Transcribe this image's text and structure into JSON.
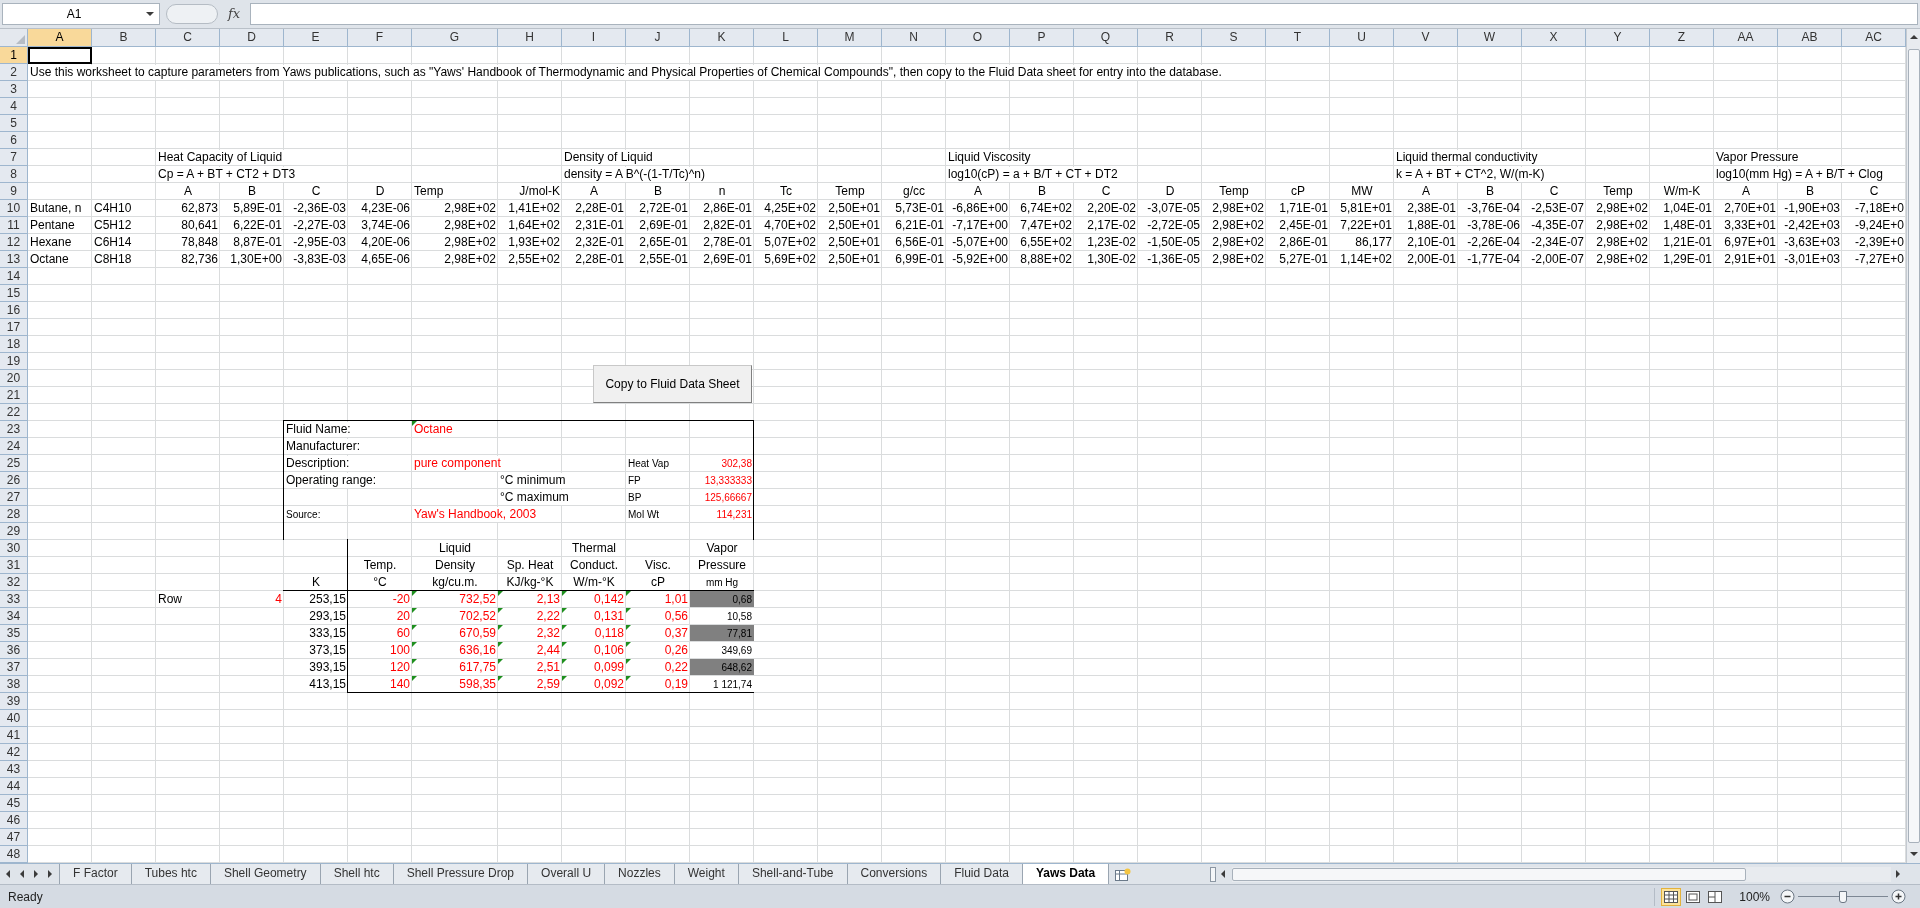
{
  "name_box": {
    "value": "A1"
  },
  "formula_bar": {
    "function_label": "fx"
  },
  "column_headers": [
    {
      "label": "A",
      "selected": true
    },
    {
      "label": "B",
      "selected": false
    },
    {
      "label": "C",
      "selected": false
    },
    {
      "label": "D",
      "selected": false
    },
    {
      "label": "E",
      "selected": false
    },
    {
      "label": "F",
      "selected": false
    },
    {
      "label": "G",
      "selected": false
    },
    {
      "label": "H",
      "selected": false
    },
    {
      "label": "I",
      "selected": false
    },
    {
      "label": "J",
      "selected": false
    },
    {
      "label": "K",
      "selected": false
    },
    {
      "label": "L",
      "selected": false
    },
    {
      "label": "M",
      "selected": false
    },
    {
      "label": "N",
      "selected": false
    },
    {
      "label": "O",
      "selected": false
    },
    {
      "label": "P",
      "selected": false
    },
    {
      "label": "Q",
      "selected": false
    },
    {
      "label": "R",
      "selected": false
    },
    {
      "label": "S",
      "selected": false
    },
    {
      "label": "T",
      "selected": false
    },
    {
      "label": "U",
      "selected": false
    },
    {
      "label": "V",
      "selected": false
    },
    {
      "label": "W",
      "selected": false
    },
    {
      "label": "X",
      "selected": false
    },
    {
      "label": "Y",
      "selected": false
    },
    {
      "label": "Z",
      "selected": false
    },
    {
      "label": "AA",
      "selected": false
    },
    {
      "label": "AB",
      "selected": false
    },
    {
      "label": "AC",
      "selected": false
    }
  ],
  "rows": [
    {
      "number": "1",
      "selected": true,
      "cells": [
        {
          "kind": "label",
          "selected": true
        }
      ]
    },
    {
      "number": "2",
      "selected": false,
      "cells": [
        {
          "text": "Use this worksheet to capture parameters from Yaws publications, such as \"Yaws' Handbook of Thermodynamic and Physical Properties of Chemical Compounds\", then copy to the Fluid Data sheet for entry into the database.",
          "kind": "label",
          "selected": false
        }
      ]
    },
    {
      "number": "3",
      "selected": false
    },
    {
      "number": "4",
      "selected": false
    },
    {
      "number": "5",
      "selected": false
    },
    {
      "number": "6",
      "selected": false
    },
    {
      "number": "7",
      "selected": false,
      "cells": [
        null,
        null,
        {
          "text": "Heat Capacity of Liquid",
          "kind": "label",
          "selected": false
        },
        null,
        null,
        null,
        null,
        null,
        {
          "text": "Density of Liquid",
          "kind": "label",
          "selected": false
        },
        null,
        null,
        null,
        null,
        null,
        {
          "text": "Liquid Viscosity",
          "kind": "label",
          "selected": false
        },
        null,
        null,
        null,
        null,
        null,
        null,
        {
          "text": "Liquid thermal conductivity",
          "kind": "label",
          "selected": false
        },
        null,
        null,
        null,
        null,
        {
          "text": "Vapor Pressure",
          "kind": "label",
          "selected": false
        }
      ]
    },
    {
      "number": "8",
      "selected": false,
      "cells": [
        null,
        null,
        {
          "text": "Cp = A + BT + CT2 + DT3",
          "kind": "label",
          "selected": false
        },
        null,
        null,
        null,
        null,
        null,
        {
          "text": "density = A B^(-(1-T/Tc)^n)",
          "kind": "label",
          "selected": false
        },
        null,
        null,
        null,
        null,
        null,
        {
          "text": "log10(cP) = a + B/T + CT + DT2",
          "kind": "label",
          "selected": false
        },
        null,
        null,
        null,
        null,
        null,
        null,
        {
          "text": "k = A + BT + CT^2, W/(m-K)",
          "kind": "label",
          "selected": false
        },
        null,
        null,
        null,
        null,
        {
          "text": "log10(mm Hg) = A + B/T + Clog",
          "kind": "label",
          "selected": false
        }
      ]
    },
    {
      "number": "9",
      "selected": false,
      "cells": [
        null,
        null,
        {
          "text": "A",
          "kind": "heading",
          "selected": false
        },
        {
          "text": "B",
          "kind": "heading",
          "selected": false
        },
        {
          "text": "C",
          "kind": "heading",
          "selected": false
        },
        {
          "text": "D",
          "kind": "heading",
          "selected": false
        },
        {
          "text": "Temp",
          "kind": "label",
          "selected": false
        },
        {
          "text": "J/mol-K",
          "kind": "number",
          "selected": false
        },
        {
          "text": "A",
          "kind": "heading",
          "selected": false
        },
        {
          "text": "B",
          "kind": "heading",
          "selected": false
        },
        {
          "text": "n",
          "kind": "heading",
          "selected": false
        },
        {
          "text": "Tc",
          "kind": "heading",
          "selected": false
        },
        {
          "text": "Temp",
          "kind": "heading",
          "selected": false
        },
        {
          "text": "g/cc",
          "kind": "heading",
          "selected": false
        },
        {
          "text": "A",
          "kind": "heading",
          "selected": false
        },
        {
          "text": "B",
          "kind": "heading",
          "selected": false
        },
        {
          "text": "C",
          "kind": "heading",
          "selected": false
        },
        {
          "text": "D",
          "kind": "heading",
          "selected": false
        },
        {
          "text": "Temp",
          "kind": "heading",
          "selected": false
        },
        {
          "text": "cP",
          "kind": "heading",
          "selected": false
        },
        {
          "text": "MW",
          "kind": "heading",
          "selected": false
        },
        {
          "text": "A",
          "kind": "heading",
          "selected": false
        },
        {
          "text": "B",
          "kind": "heading",
          "selected": false
        },
        {
          "text": "C",
          "kind": "heading",
          "selected": false
        },
        {
          "text": "Temp",
          "kind": "heading",
          "selected": false
        },
        {
          "text": "W/m-K",
          "kind": "heading",
          "selected": false
        },
        {
          "text": "A",
          "kind": "heading",
          "selected": false
        },
        {
          "text": "B",
          "kind": "heading",
          "selected": false
        },
        {
          "text": "C",
          "kind": "heading",
          "selected": false
        }
      ]
    },
    {
      "number": "10",
      "selected": false,
      "cells": [
        {
          "text": "Butane, n",
          "kind": "label",
          "selected": false
        },
        {
          "text": "C4H10",
          "kind": "label",
          "selected": false
        },
        {
          "text": "62,873",
          "kind": "number",
          "selected": false
        },
        {
          "text": "5,89E-01",
          "kind": "number",
          "selected": false
        },
        {
          "text": "-2,36E-03",
          "kind": "number",
          "selected": false
        },
        {
          "text": "4,23E-06",
          "kind": "number",
          "selected": false
        },
        {
          "text": "2,98E+02",
          "kind": "number",
          "selected": false
        },
        {
          "text": "1,41E+02",
          "kind": "number",
          "selected": false
        },
        {
          "text": "2,28E-01",
          "kind": "number",
          "selected": false
        },
        {
          "text": "2,72E-01",
          "kind": "number",
          "selected": false
        },
        {
          "text": "2,86E-01",
          "kind": "number",
          "selected": false
        },
        {
          "text": "4,25E+02",
          "kind": "number",
          "selected": false
        },
        {
          "text": "2,50E+01",
          "kind": "number",
          "selected": false
        },
        {
          "text": "5,73E-01",
          "kind": "number",
          "selected": false
        },
        {
          "text": "-6,86E+00",
          "kind": "number",
          "selected": false
        },
        {
          "text": "6,74E+02",
          "kind": "number",
          "selected": false
        },
        {
          "text": "2,20E-02",
          "kind": "number",
          "selected": false
        },
        {
          "text": "-3,07E-05",
          "kind": "number",
          "selected": false
        },
        {
          "text": "2,98E+02",
          "kind": "number",
          "selected": false
        },
        {
          "text": "1,71E-01",
          "kind": "number",
          "selected": false
        },
        {
          "text": "5,81E+01",
          "kind": "number",
          "selected": false
        },
        {
          "text": "2,38E-01",
          "kind": "number",
          "selected": false
        },
        {
          "text": "-3,76E-04",
          "kind": "number",
          "selected": false
        },
        {
          "text": "-2,53E-07",
          "kind": "number",
          "selected": false
        },
        {
          "text": "2,98E+02",
          "kind": "number",
          "selected": false
        },
        {
          "text": "1,04E-01",
          "kind": "number",
          "selected": false
        },
        {
          "text": "2,70E+01",
          "kind": "number",
          "selected": false
        },
        {
          "text": "-1,90E+03",
          "kind": "number",
          "selected": false
        },
        {
          "text": "-7,18E+0",
          "kind": "number",
          "selected": false
        }
      ]
    },
    {
      "number": "11",
      "selected": false,
      "cells": [
        {
          "text": "Pentane",
          "kind": "label",
          "selected": false
        },
        {
          "text": "C5H12",
          "kind": "label",
          "selected": false
        },
        {
          "text": "80,641",
          "kind": "number",
          "selected": false
        },
        {
          "text": "6,22E-01",
          "kind": "number",
          "selected": false
        },
        {
          "text": "-2,27E-03",
          "kind": "number",
          "selected": false
        },
        {
          "text": "3,74E-06",
          "kind": "number",
          "selected": false
        },
        {
          "text": "2,98E+02",
          "kind": "number",
          "selected": false
        },
        {
          "text": "1,64E+02",
          "kind": "number",
          "selected": false
        },
        {
          "text": "2,31E-01",
          "kind": "number",
          "selected": false
        },
        {
          "text": "2,69E-01",
          "kind": "number",
          "selected": false
        },
        {
          "text": "2,82E-01",
          "kind": "number",
          "selected": false
        },
        {
          "text": "4,70E+02",
          "kind": "number",
          "selected": false
        },
        {
          "text": "2,50E+01",
          "kind": "number",
          "selected": false
        },
        {
          "text": "6,21E-01",
          "kind": "number",
          "selected": false
        },
        {
          "text": "-7,17E+00",
          "kind": "number",
          "selected": false
        },
        {
          "text": "7,47E+02",
          "kind": "number",
          "selected": false
        },
        {
          "text": "2,17E-02",
          "kind": "number",
          "selected": false
        },
        {
          "text": "-2,72E-05",
          "kind": "number",
          "selected": false
        },
        {
          "text": "2,98E+02",
          "kind": "number",
          "selected": false
        },
        {
          "text": "2,45E-01",
          "kind": "number",
          "selected": false
        },
        {
          "text": "7,22E+01",
          "kind": "number",
          "selected": false
        },
        {
          "text": "1,88E-01",
          "kind": "number",
          "selected": false
        },
        {
          "text": "-3,78E-06",
          "kind": "number",
          "selected": false
        },
        {
          "text": "-4,35E-07",
          "kind": "number",
          "selected": false
        },
        {
          "text": "2,98E+02",
          "kind": "number",
          "selected": false
        },
        {
          "text": "1,48E-01",
          "kind": "number",
          "selected": false
        },
        {
          "text": "3,33E+01",
          "kind": "number",
          "selected": false
        },
        {
          "text": "-2,42E+03",
          "kind": "number",
          "selected": false
        },
        {
          "text": "-9,24E+0",
          "kind": "number",
          "selected": false
        }
      ]
    },
    {
      "number": "12",
      "selected": false,
      "cells": [
        {
          "text": "Hexane",
          "kind": "label",
          "selected": false
        },
        {
          "text": "C6H14",
          "kind": "label",
          "selected": false
        },
        {
          "text": "78,848",
          "kind": "number",
          "selected": false
        },
        {
          "text": "8,87E-01",
          "kind": "number",
          "selected": false
        },
        {
          "text": "-2,95E-03",
          "kind": "number",
          "selected": false
        },
        {
          "text": "4,20E-06",
          "kind": "number",
          "selected": false
        },
        {
          "text": "2,98E+02",
          "kind": "number",
          "selected": false
        },
        {
          "text": "1,93E+02",
          "kind": "number",
          "selected": false
        },
        {
          "text": "2,32E-01",
          "kind": "number",
          "selected": false
        },
        {
          "text": "2,65E-01",
          "kind": "number",
          "selected": false
        },
        {
          "text": "2,78E-01",
          "kind": "number",
          "selected": false
        },
        {
          "text": "5,07E+02",
          "kind": "number",
          "selected": false
        },
        {
          "text": "2,50E+01",
          "kind": "number",
          "selected": false
        },
        {
          "text": "6,56E-01",
          "kind": "number",
          "selected": false
        },
        {
          "text": "-5,07E+00",
          "kind": "number",
          "selected": false
        },
        {
          "text": "6,55E+02",
          "kind": "number",
          "selected": false
        },
        {
          "text": "1,23E-02",
          "kind": "number",
          "selected": false
        },
        {
          "text": "-1,50E-05",
          "kind": "number",
          "selected": false
        },
        {
          "text": "2,98E+02",
          "kind": "number",
          "selected": false
        },
        {
          "text": "2,86E-01",
          "kind": "number",
          "selected": false
        },
        {
          "text": "86,177",
          "kind": "number",
          "selected": false
        },
        {
          "text": "2,10E-01",
          "kind": "number",
          "selected": false
        },
        {
          "text": "-2,26E-04",
          "kind": "number",
          "selected": false
        },
        {
          "text": "-2,34E-07",
          "kind": "number",
          "selected": false
        },
        {
          "text": "2,98E+02",
          "kind": "number",
          "selected": false
        },
        {
          "text": "1,21E-01",
          "kind": "number",
          "selected": false
        },
        {
          "text": "6,97E+01",
          "kind": "number",
          "selected": false
        },
        {
          "text": "-3,63E+03",
          "kind": "number",
          "selected": false
        },
        {
          "text": "-2,39E+0",
          "kind": "number",
          "selected": false
        }
      ]
    },
    {
      "number": "13",
      "selected": false,
      "cells": [
        {
          "text": "Octane",
          "kind": "label",
          "selected": false
        },
        {
          "text": "C8H18",
          "kind": "label",
          "selected": false
        },
        {
          "text": "82,736",
          "kind": "number",
          "selected": false
        },
        {
          "text": "1,30E+00",
          "kind": "number",
          "selected": false
        },
        {
          "text": "-3,83E-03",
          "kind": "number",
          "selected": false
        },
        {
          "text": "4,65E-06",
          "kind": "number",
          "selected": false
        },
        {
          "text": "2,98E+02",
          "kind": "number",
          "selected": false
        },
        {
          "text": "2,55E+02",
          "kind": "number",
          "selected": false
        },
        {
          "text": "2,28E-01",
          "kind": "number",
          "selected": false
        },
        {
          "text": "2,55E-01",
          "kind": "number",
          "selected": false
        },
        {
          "text": "2,69E-01",
          "kind": "number",
          "selected": false
        },
        {
          "text": "5,69E+02",
          "kind": "number",
          "selected": false
        },
        {
          "text": "2,50E+01",
          "kind": "number",
          "selected": false
        },
        {
          "text": "6,99E-01",
          "kind": "number",
          "selected": false
        },
        {
          "text": "-5,92E+00",
          "kind": "number",
          "selected": false
        },
        {
          "text": "8,88E+02",
          "kind": "number",
          "selected": false
        },
        {
          "text": "1,30E-02",
          "kind": "number",
          "selected": false
        },
        {
          "text": "-1,36E-05",
          "kind": "number",
          "selected": false
        },
        {
          "text": "2,98E+02",
          "kind": "number",
          "selected": false
        },
        {
          "text": "5,27E-01",
          "kind": "number",
          "selected": false
        },
        {
          "text": "1,14E+02",
          "kind": "number",
          "selected": false
        },
        {
          "text": "2,00E-01",
          "kind": "number",
          "selected": false
        },
        {
          "text": "-1,77E-04",
          "kind": "number",
          "selected": false
        },
        {
          "text": "-2,00E-07",
          "kind": "number",
          "selected": false
        },
        {
          "text": "2,98E+02",
          "kind": "number",
          "selected": false
        },
        {
          "text": "1,29E-01",
          "kind": "number",
          "selected": false
        },
        {
          "text": "2,91E+01",
          "kind": "number",
          "selected": false
        },
        {
          "text": "-3,01E+03",
          "kind": "number",
          "selected": false
        },
        {
          "text": "-7,27E+0",
          "kind": "number",
          "selected": false
        }
      ]
    },
    {
      "number": "14",
      "selected": false
    },
    {
      "number": "15",
      "selected": false
    },
    {
      "number": "16",
      "selected": false
    },
    {
      "number": "17",
      "selected": false
    },
    {
      "number": "18",
      "selected": false
    },
    {
      "number": "19",
      "selected": false
    },
    {
      "number": "20",
      "selected": false
    },
    {
      "number": "21",
      "selected": false
    },
    {
      "number": "22",
      "selected": false
    },
    {
      "number": "23",
      "selected": false,
      "cells": [
        null,
        null,
        null,
        null,
        {
          "text": "Fluid Name:",
          "kind": "label",
          "selected": false
        },
        null,
        {
          "text": "Octane",
          "kind": "entry",
          "selected": false,
          "flagged": true
        }
      ]
    },
    {
      "number": "24",
      "selected": false,
      "cells": [
        null,
        null,
        null,
        null,
        {
          "text": "Manufacturer:",
          "kind": "label",
          "selected": false
        }
      ]
    },
    {
      "number": "25",
      "selected": false,
      "cells": [
        null,
        null,
        null,
        null,
        {
          "text": "Description:",
          "kind": "label",
          "selected": false
        },
        null,
        {
          "text": "pure component",
          "kind": "entry",
          "selected": false
        },
        null,
        null,
        {
          "text": "Heat Vap",
          "kind": "note",
          "selected": false
        },
        {
          "text": "302,38",
          "kind": "entry-note-number",
          "selected": false
        }
      ]
    },
    {
      "number": "26",
      "selected": false,
      "cells": [
        null,
        null,
        null,
        null,
        {
          "text": "Operating range:",
          "kind": "label",
          "selected": false
        },
        null,
        null,
        {
          "text": "°C minimum",
          "kind": "label",
          "selected": false
        },
        null,
        {
          "text": "FP",
          "kind": "note",
          "selected": false
        },
        {
          "text": "13,333333",
          "kind": "entry-note-number",
          "selected": false
        }
      ]
    },
    {
      "number": "27",
      "selected": false,
      "cells": [
        null,
        null,
        null,
        null,
        null,
        null,
        null,
        {
          "text": "°C maximum",
          "kind": "label",
          "selected": false
        },
        null,
        {
          "text": "BP",
          "kind": "note",
          "selected": false
        },
        {
          "text": "125,66667",
          "kind": "entry-note-number",
          "selected": false
        }
      ]
    },
    {
      "number": "28",
      "selected": false,
      "cells": [
        null,
        null,
        null,
        null,
        {
          "text": "Source:",
          "kind": "note",
          "selected": false
        },
        null,
        {
          "text": "Yaw's Handbook, 2003",
          "kind": "entry",
          "selected": false
        },
        null,
        null,
        {
          "text": "Mol Wt",
          "kind": "note",
          "selected": false
        },
        {
          "text": "114,231",
          "kind": "entry-note-number",
          "selected": false
        }
      ]
    },
    {
      "number": "29",
      "selected": false
    },
    {
      "number": "30",
      "selected": false,
      "cells": [
        null,
        null,
        null,
        null,
        null,
        null,
        {
          "text": "Liquid",
          "kind": "heading",
          "selected": false
        },
        null,
        {
          "text": "Thermal",
          "kind": "heading",
          "selected": false
        },
        null,
        {
          "text": "Vapor",
          "kind": "heading",
          "selected": false
        }
      ]
    },
    {
      "number": "31",
      "selected": false,
      "cells": [
        null,
        null,
        null,
        null,
        null,
        {
          "text": "Temp.",
          "kind": "heading",
          "selected": false
        },
        {
          "text": "Density",
          "kind": "heading",
          "selected": false
        },
        {
          "text": "Sp. Heat",
          "kind": "heading",
          "selected": false
        },
        {
          "text": "Conduct.",
          "kind": "heading",
          "selected": false
        },
        {
          "text": "Visc.",
          "kind": "heading",
          "selected": false
        },
        {
          "text": "Pressure",
          "kind": "heading",
          "selected": false
        }
      ]
    },
    {
      "number": "32",
      "selected": false,
      "cells": [
        null,
        null,
        null,
        null,
        {
          "text": "K",
          "kind": "heading",
          "selected": false
        },
        {
          "text": "°C",
          "kind": "heading",
          "selected": false
        },
        {
          "text": "kg/cu.m.",
          "kind": "heading",
          "selected": false
        },
        {
          "text": "KJ/kg-°K",
          "kind": "heading",
          "selected": false
        },
        {
          "text": "W/m-°K",
          "kind": "heading",
          "selected": false
        },
        {
          "text": "cP",
          "kind": "heading",
          "selected": false
        },
        {
          "text": "mm Hg",
          "kind": "note-heading",
          "selected": false
        }
      ]
    },
    {
      "number": "33",
      "selected": false,
      "cells": [
        null,
        null,
        {
          "text": "Row",
          "kind": "label",
          "selected": false
        },
        {
          "text": "4",
          "kind": "entry-number",
          "selected": false
        },
        {
          "text": "253,15",
          "kind": "number",
          "selected": false
        },
        {
          "text": "-20",
          "kind": "entry-number",
          "selected": false
        },
        {
          "text": "732,52",
          "kind": "entry-number",
          "selected": false,
          "flagged": true
        },
        {
          "text": "2,13",
          "kind": "entry-number",
          "selected": false,
          "flagged": true
        },
        {
          "text": "0,142",
          "kind": "entry-number",
          "selected": false,
          "flagged": true
        },
        {
          "text": "1,01",
          "kind": "entry-number",
          "selected": false,
          "flagged": true
        },
        {
          "text": "0,68",
          "kind": "note-number",
          "selected": false,
          "shaded": true
        }
      ]
    },
    {
      "number": "34",
      "selected": false,
      "cells": [
        null,
        null,
        null,
        null,
        {
          "text": "293,15",
          "kind": "number",
          "selected": false
        },
        {
          "text": "20",
          "kind": "entry-number",
          "selected": false
        },
        {
          "text": "702,52",
          "kind": "entry-number",
          "selected": false,
          "flagged": true
        },
        {
          "text": "2,22",
          "kind": "entry-number",
          "selected": false,
          "flagged": true
        },
        {
          "text": "0,131",
          "kind": "entry-number",
          "selected": false,
          "flagged": true
        },
        {
          "text": "0,56",
          "kind": "entry-number",
          "selected": false,
          "flagged": true
        },
        {
          "text": "10,58",
          "kind": "note-number",
          "selected": false,
          "shaded": false
        }
      ]
    },
    {
      "number": "35",
      "selected": false,
      "cells": [
        null,
        null,
        null,
        null,
        {
          "text": "333,15",
          "kind": "number",
          "selected": false
        },
        {
          "text": "60",
          "kind": "entry-number",
          "selected": false
        },
        {
          "text": "670,59",
          "kind": "entry-number",
          "selected": false,
          "flagged": true
        },
        {
          "text": "2,32",
          "kind": "entry-number",
          "selected": false,
          "flagged": true
        },
        {
          "text": "0,118",
          "kind": "entry-number",
          "selected": false,
          "flagged": true
        },
        {
          "text": "0,37",
          "kind": "entry-number",
          "selected": false,
          "flagged": true
        },
        {
          "text": "77,81",
          "kind": "note-number",
          "selected": false,
          "shaded": true
        }
      ]
    },
    {
      "number": "36",
      "selected": false,
      "cells": [
        null,
        null,
        null,
        null,
        {
          "text": "373,15",
          "kind": "number",
          "selected": false
        },
        {
          "text": "100",
          "kind": "entry-number",
          "selected": false
        },
        {
          "text": "636,16",
          "kind": "entry-number",
          "selected": false,
          "flagged": true
        },
        {
          "text": "2,44",
          "kind": "entry-number",
          "selected": false,
          "flagged": true
        },
        {
          "text": "0,106",
          "kind": "entry-number",
          "selected": false,
          "flagged": true
        },
        {
          "text": "0,26",
          "kind": "entry-number",
          "selected": false,
          "flagged": true
        },
        {
          "text": "349,69",
          "kind": "note-number",
          "selected": false,
          "shaded": false
        }
      ]
    },
    {
      "number": "37",
      "selected": false,
      "cells": [
        null,
        null,
        null,
        null,
        {
          "text": "393,15",
          "kind": "number",
          "selected": false
        },
        {
          "text": "120",
          "kind": "entry-number",
          "selected": false
        },
        {
          "text": "617,75",
          "kind": "entry-number",
          "selected": false,
          "flagged": true
        },
        {
          "text": "2,51",
          "kind": "entry-number",
          "selected": false,
          "flagged": true
        },
        {
          "text": "0,099",
          "kind": "entry-number",
          "selected": false,
          "flagged": true
        },
        {
          "text": "0,22",
          "kind": "entry-number",
          "selected": false,
          "flagged": true
        },
        {
          "text": "648,62",
          "kind": "note-number",
          "selected": false,
          "shaded": true
        }
      ]
    },
    {
      "number": "38",
      "selected": false,
      "cells": [
        null,
        null,
        null,
        null,
        {
          "text": "413,15",
          "kind": "number",
          "selected": false
        },
        {
          "text": "140",
          "kind": "entry-number",
          "selected": false
        },
        {
          "text": "598,35",
          "kind": "entry-number",
          "selected": false,
          "flagged": true
        },
        {
          "text": "2,59",
          "kind": "entry-number",
          "selected": false,
          "flagged": true
        },
        {
          "text": "0,092",
          "kind": "entry-number",
          "selected": false,
          "flagged": true
        },
        {
          "text": "0,19",
          "kind": "entry-number",
          "selected": false,
          "flagged": true
        },
        {
          "text": "1 121,74",
          "kind": "note-number",
          "selected": false,
          "shaded": false
        }
      ]
    },
    {
      "number": "39",
      "selected": false
    },
    {
      "number": "40",
      "selected": false
    },
    {
      "number": "41",
      "selected": false
    },
    {
      "number": "42",
      "selected": false
    },
    {
      "number": "43",
      "selected": false
    },
    {
      "number": "44",
      "selected": false
    },
    {
      "number": "45",
      "selected": false
    },
    {
      "number": "46",
      "selected": false
    },
    {
      "number": "47",
      "selected": false
    },
    {
      "number": "48",
      "selected": false
    }
  ],
  "button": {
    "label": "Copy to Fluid Data Sheet"
  },
  "sheet_tabs": [
    {
      "label": "F Factor",
      "selected": false
    },
    {
      "label": "Tubes htc",
      "selected": false
    },
    {
      "label": "Shell Geometry",
      "selected": false
    },
    {
      "label": "Shell htc",
      "selected": false
    },
    {
      "label": "Shell Pressure Drop",
      "selected": false
    },
    {
      "label": "Overall U",
      "selected": false
    },
    {
      "label": "Nozzles",
      "selected": false
    },
    {
      "label": "Weight",
      "selected": false
    },
    {
      "label": "Shell-and-Tube",
      "selected": false
    },
    {
      "label": "Conversions",
      "selected": false
    },
    {
      "label": "Fluid Data",
      "selected": false
    },
    {
      "label": "Yaws Data",
      "selected": true
    }
  ],
  "status_bar": {
    "status": "Ready",
    "views": [
      {
        "kind": "normal",
        "selected": true
      },
      {
        "kind": "page-layout",
        "selected": false
      },
      {
        "kind": "page-break",
        "selected": false
      }
    ],
    "zoom": {
      "reading": "100%",
      "level": 0.5
    }
  }
}
